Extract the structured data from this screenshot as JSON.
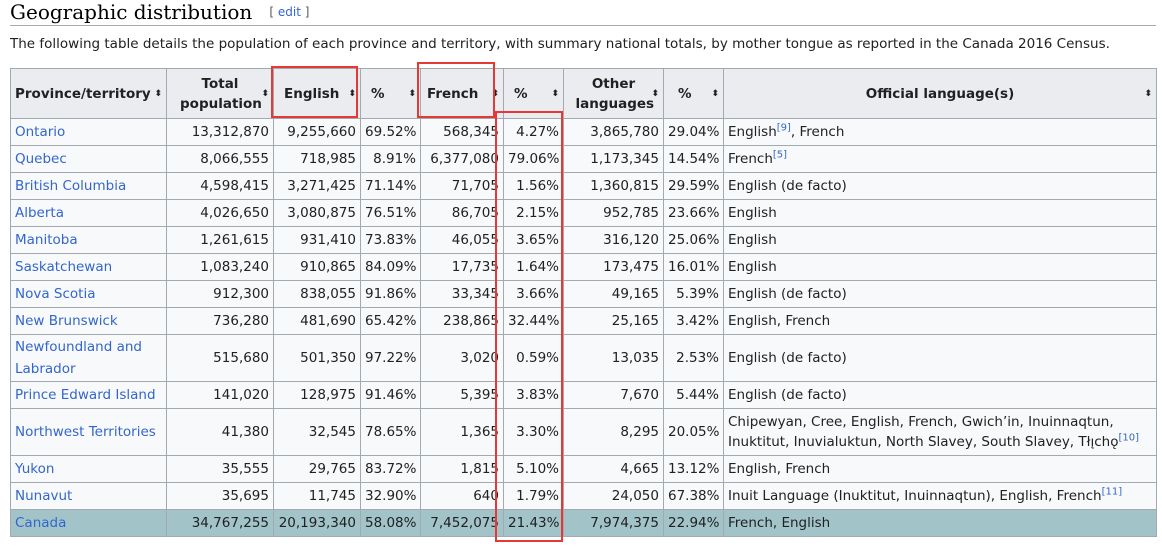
{
  "section": {
    "title": "Geographic distribution",
    "edit_open": "[ ",
    "edit_label": "edit",
    "edit_close": " ]"
  },
  "intro": "The following table details the population of each province and territory, with summary national totals, by mother tongue as reported in the Canada 2016 Census.",
  "table": {
    "headers": [
      {
        "label": "Province/territory"
      },
      {
        "label": "Total population"
      },
      {
        "label": "English"
      },
      {
        "label": "%"
      },
      {
        "label": "French"
      },
      {
        "label": "%"
      },
      {
        "label": "Other languages"
      },
      {
        "label": "%"
      },
      {
        "label": "Official language(s)"
      }
    ],
    "sort_icon": "⬍",
    "rows": [
      {
        "name": "Ontario",
        "total": "13,312,870",
        "english": "9,255,660",
        "english_pct": "69.52%",
        "french": "568,345",
        "french_pct": "4.27%",
        "other": "3,865,780",
        "other_pct": "29.04%",
        "official": "English",
        "sup": "[9]",
        "official_after": ", French"
      },
      {
        "name": "Quebec",
        "total": "8,066,555",
        "english": "718,985",
        "english_pct": "8.91%",
        "french": "6,377,080",
        "french_pct": "79.06%",
        "other": "1,173,345",
        "other_pct": "14.54%",
        "official": "French",
        "sup": "[5]",
        "official_after": ""
      },
      {
        "name": "British Columbia",
        "total": "4,598,415",
        "english": "3,271,425",
        "english_pct": "71.14%",
        "french": "71,705",
        "french_pct": "1.56%",
        "other": "1,360,815",
        "other_pct": "29.59%",
        "official": "English (de facto)",
        "sup": "",
        "official_after": ""
      },
      {
        "name": "Alberta",
        "total": "4,026,650",
        "english": "3,080,875",
        "english_pct": "76.51%",
        "french": "86,705",
        "french_pct": "2.15%",
        "other": "952,785",
        "other_pct": "23.66%",
        "official": "English",
        "sup": "",
        "official_after": ""
      },
      {
        "name": "Manitoba",
        "total": "1,261,615",
        "english": "931,410",
        "english_pct": "73.83%",
        "french": "46,055",
        "french_pct": "3.65%",
        "other": "316,120",
        "other_pct": "25.06%",
        "official": "English",
        "sup": "",
        "official_after": ""
      },
      {
        "name": "Saskatchewan",
        "total": "1,083,240",
        "english": "910,865",
        "english_pct": "84.09%",
        "french": "17,735",
        "french_pct": "1.64%",
        "other": "173,475",
        "other_pct": "16.01%",
        "official": "English",
        "sup": "",
        "official_after": ""
      },
      {
        "name": "Nova Scotia",
        "total": "912,300",
        "english": "838,055",
        "english_pct": "91.86%",
        "french": "33,345",
        "french_pct": "3.66%",
        "other": "49,165",
        "other_pct": "5.39%",
        "official": "English (de facto)",
        "sup": "",
        "official_after": ""
      },
      {
        "name": "New Brunswick",
        "total": "736,280",
        "english": "481,690",
        "english_pct": "65.42%",
        "french": "238,865",
        "french_pct": "32.44%",
        "other": "25,165",
        "other_pct": "3.42%",
        "official": "English, French",
        "sup": "",
        "official_after": ""
      },
      {
        "name": "Newfoundland and Labrador",
        "total": "515,680",
        "english": "501,350",
        "english_pct": "97.22%",
        "french": "3,020",
        "french_pct": "0.59%",
        "other": "13,035",
        "other_pct": "2.53%",
        "official": "English (de facto)",
        "sup": "",
        "official_after": ""
      },
      {
        "name": "Prince Edward Island",
        "total": "141,020",
        "english": "128,975",
        "english_pct": "91.46%",
        "french": "5,395",
        "french_pct": "3.83%",
        "other": "7,670",
        "other_pct": "5.44%",
        "official": "English (de facto)",
        "sup": "",
        "official_after": ""
      },
      {
        "name": "Northwest Territories",
        "total": "41,380",
        "english": "32,545",
        "english_pct": "78.65%",
        "french": "1,365",
        "french_pct": "3.30%",
        "other": "8,295",
        "other_pct": "20.05%",
        "official": "Chipewyan, Cree, English, French, Gwich’in, Inuinnaqtun, Inuktitut, Inuvialuktun, North Slavey, South Slavey, Tłı̨chǫ",
        "sup": "[10]",
        "official_after": ""
      },
      {
        "name": "Yukon",
        "total": "35,555",
        "english": "29,765",
        "english_pct": "83.72%",
        "french": "1,815",
        "french_pct": "5.10%",
        "other": "4,665",
        "other_pct": "13.12%",
        "official": "English, French",
        "sup": "",
        "official_after": ""
      },
      {
        "name": "Nunavut",
        "total": "35,695",
        "english": "11,745",
        "english_pct": "32.90%",
        "french": "640",
        "french_pct": "1.79%",
        "other": "24,050",
        "other_pct": "67.38%",
        "official": "Inuit Language (Inuktitut, Inuinnaqtun), English, French",
        "sup": "[11]",
        "official_after": ""
      }
    ],
    "total_row": {
      "name": "Canada",
      "total": "34,767,255",
      "english": "20,193,340",
      "english_pct": "58.08%",
      "french": "7,452,075",
      "french_pct": "21.43%",
      "other": "7,974,375",
      "other_pct": "22.94%",
      "official": "French, English"
    }
  },
  "colors": {
    "link": "#3366cc",
    "header_bg": "#eaecf0",
    "total_bg": "#a2c4c9",
    "highlight": "#e53935",
    "border": "#a2a9b1"
  }
}
